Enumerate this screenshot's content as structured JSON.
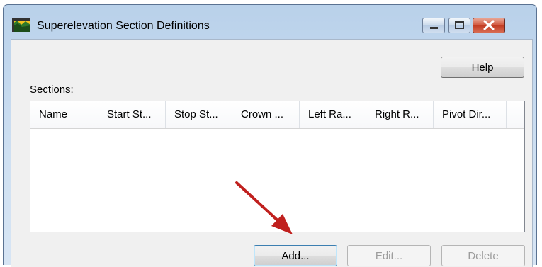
{
  "window": {
    "title": "Superelevation Section Definitions"
  },
  "caption_buttons": {
    "minimize": "minimize-icon",
    "maximize": "maximize-icon",
    "close": "close-icon"
  },
  "help_label": "Help",
  "sections_label": "Sections:",
  "columns": [
    "Name",
    "Start St...",
    "Stop St...",
    "Crown ...",
    "Left Ra...",
    "Right R...",
    "Pivot Dir..."
  ],
  "buttons": {
    "add": "Add...",
    "edit": "Edit...",
    "delete": "Delete"
  },
  "colors": {
    "arrow": "#c0201e",
    "close_button": "#c23b22"
  }
}
